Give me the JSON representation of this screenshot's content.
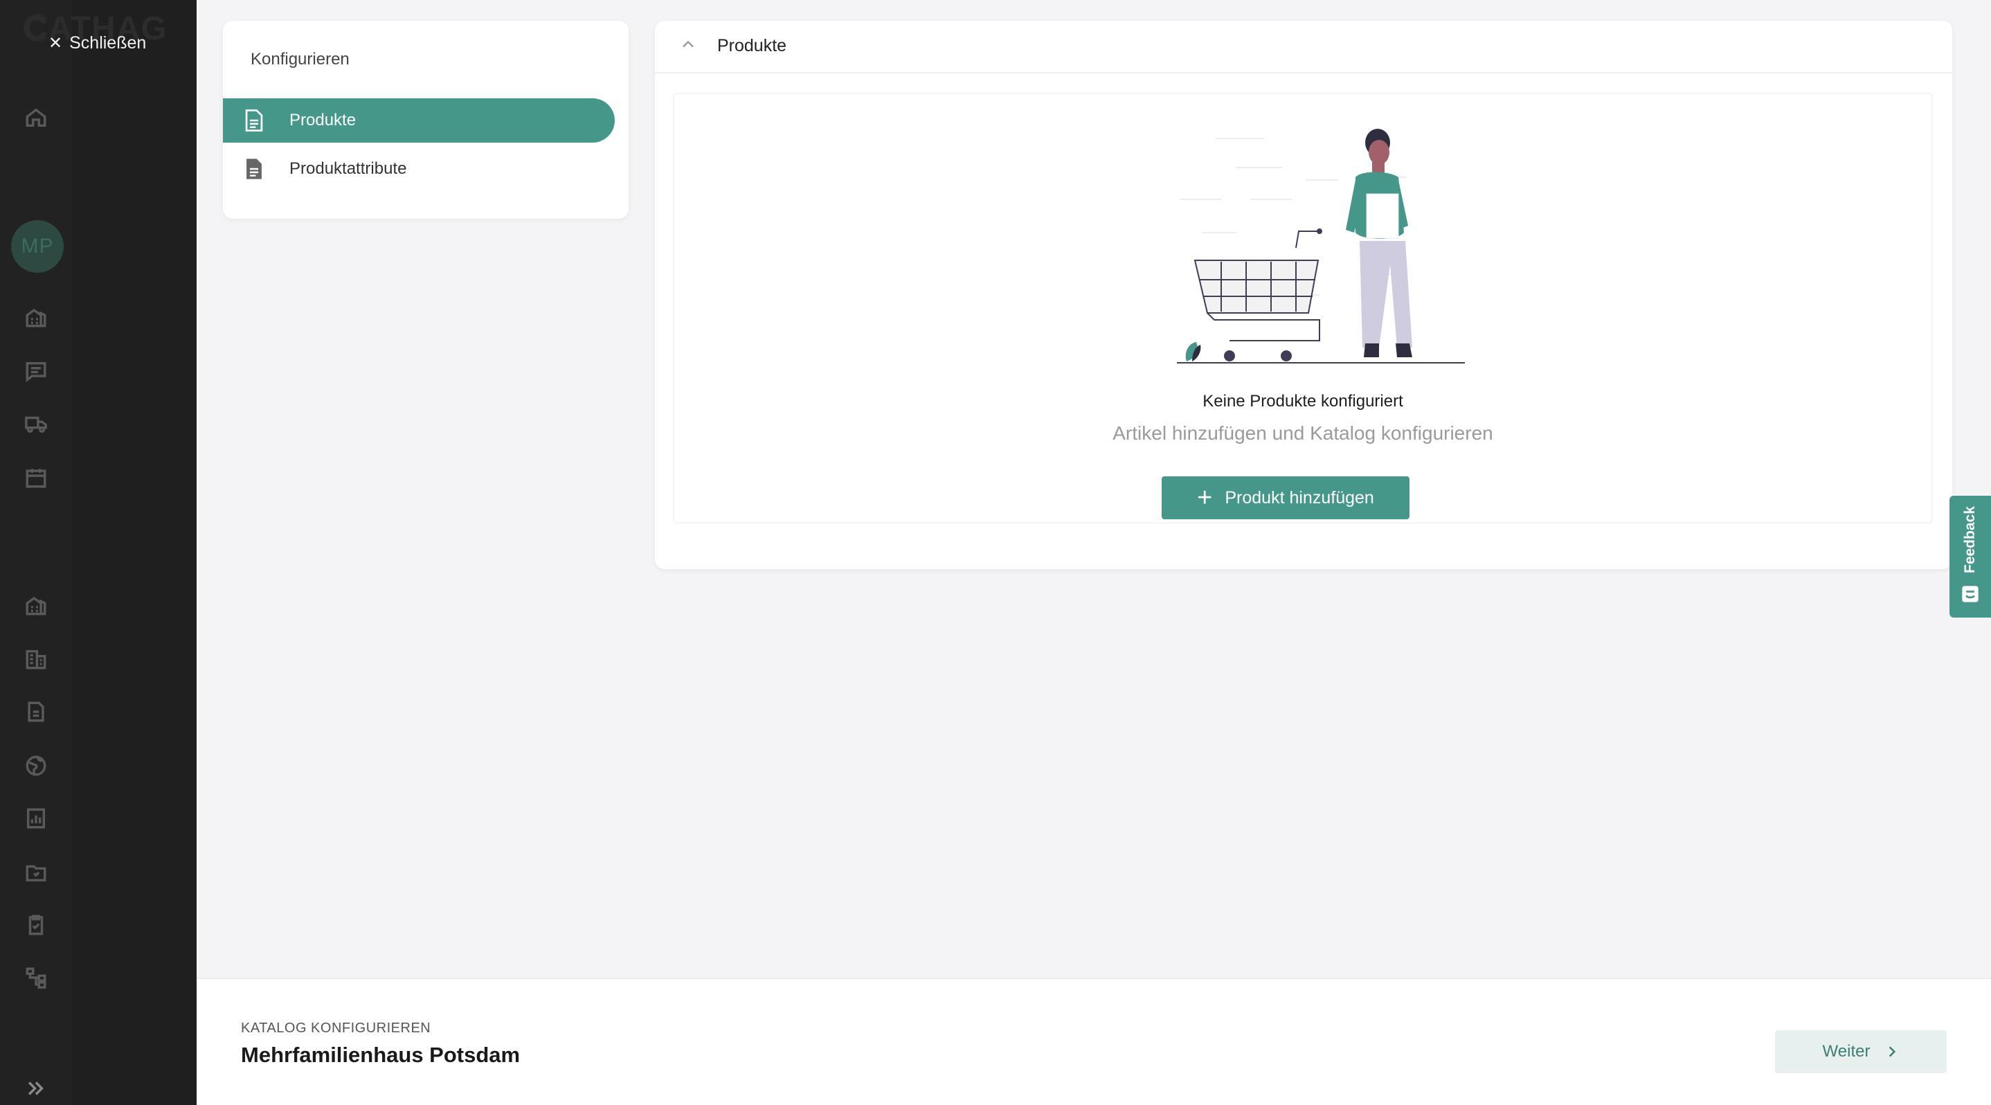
{
  "sidebar": {
    "brand": "CATHAG",
    "close_label": "Schließen",
    "avatar_initials": "MP",
    "icons": [
      "home-icon",
      "building-icon",
      "chat-icon",
      "truck-icon",
      "calendar-icon",
      "buildings-icon",
      "company-icon",
      "document-icon",
      "globe-icon",
      "report-icon",
      "folder-icon",
      "clipboard-check-icon",
      "hierarchy-icon",
      "expand-icon"
    ]
  },
  "config": {
    "title": "Konfigurieren",
    "items": [
      {
        "label": "Produkte",
        "active": true
      },
      {
        "label": "Produktattribute",
        "active": false
      }
    ]
  },
  "main": {
    "title": "Produkte",
    "empty_title": "Keine Produkte konfiguriert",
    "empty_subtitle": "Artikel hinzufügen und Katalog konfigurieren",
    "add_button": "Produkt hinzufügen"
  },
  "feedback": {
    "label": "Feedback"
  },
  "footer": {
    "kicker": "KATALOG KONFIGURIEREN",
    "title": "Mehrfamilienhaus Potsdam",
    "next_button": "Weiter"
  },
  "colors": {
    "accent": "#459789",
    "sidebar_bg": "#1f1f1f",
    "page_bg": "#f4f4f6"
  }
}
